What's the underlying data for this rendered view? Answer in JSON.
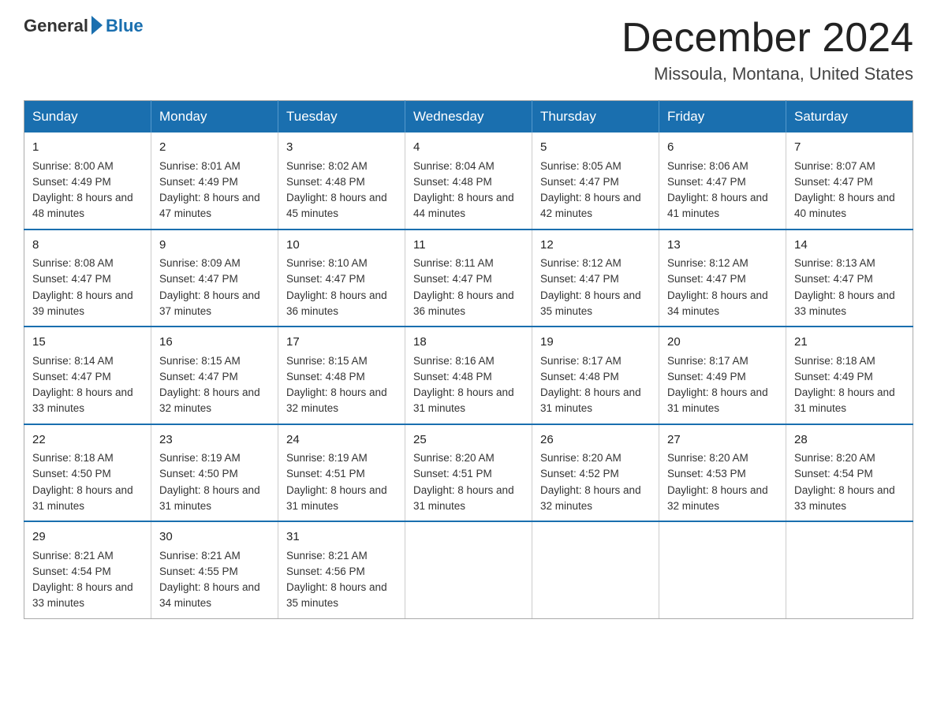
{
  "header": {
    "logo": {
      "general": "General",
      "blue": "Blue"
    },
    "month_title": "December 2024",
    "location": "Missoula, Montana, United States"
  },
  "weekdays": [
    "Sunday",
    "Monday",
    "Tuesday",
    "Wednesday",
    "Thursday",
    "Friday",
    "Saturday"
  ],
  "weeks": [
    [
      {
        "day": "1",
        "sunrise": "8:00 AM",
        "sunset": "4:49 PM",
        "daylight": "8 hours and 48 minutes."
      },
      {
        "day": "2",
        "sunrise": "8:01 AM",
        "sunset": "4:49 PM",
        "daylight": "8 hours and 47 minutes."
      },
      {
        "day": "3",
        "sunrise": "8:02 AM",
        "sunset": "4:48 PM",
        "daylight": "8 hours and 45 minutes."
      },
      {
        "day": "4",
        "sunrise": "8:04 AM",
        "sunset": "4:48 PM",
        "daylight": "8 hours and 44 minutes."
      },
      {
        "day": "5",
        "sunrise": "8:05 AM",
        "sunset": "4:47 PM",
        "daylight": "8 hours and 42 minutes."
      },
      {
        "day": "6",
        "sunrise": "8:06 AM",
        "sunset": "4:47 PM",
        "daylight": "8 hours and 41 minutes."
      },
      {
        "day": "7",
        "sunrise": "8:07 AM",
        "sunset": "4:47 PM",
        "daylight": "8 hours and 40 minutes."
      }
    ],
    [
      {
        "day": "8",
        "sunrise": "8:08 AM",
        "sunset": "4:47 PM",
        "daylight": "8 hours and 39 minutes."
      },
      {
        "day": "9",
        "sunrise": "8:09 AM",
        "sunset": "4:47 PM",
        "daylight": "8 hours and 37 minutes."
      },
      {
        "day": "10",
        "sunrise": "8:10 AM",
        "sunset": "4:47 PM",
        "daylight": "8 hours and 36 minutes."
      },
      {
        "day": "11",
        "sunrise": "8:11 AM",
        "sunset": "4:47 PM",
        "daylight": "8 hours and 36 minutes."
      },
      {
        "day": "12",
        "sunrise": "8:12 AM",
        "sunset": "4:47 PM",
        "daylight": "8 hours and 35 minutes."
      },
      {
        "day": "13",
        "sunrise": "8:12 AM",
        "sunset": "4:47 PM",
        "daylight": "8 hours and 34 minutes."
      },
      {
        "day": "14",
        "sunrise": "8:13 AM",
        "sunset": "4:47 PM",
        "daylight": "8 hours and 33 minutes."
      }
    ],
    [
      {
        "day": "15",
        "sunrise": "8:14 AM",
        "sunset": "4:47 PM",
        "daylight": "8 hours and 33 minutes."
      },
      {
        "day": "16",
        "sunrise": "8:15 AM",
        "sunset": "4:47 PM",
        "daylight": "8 hours and 32 minutes."
      },
      {
        "day": "17",
        "sunrise": "8:15 AM",
        "sunset": "4:48 PM",
        "daylight": "8 hours and 32 minutes."
      },
      {
        "day": "18",
        "sunrise": "8:16 AM",
        "sunset": "4:48 PM",
        "daylight": "8 hours and 31 minutes."
      },
      {
        "day": "19",
        "sunrise": "8:17 AM",
        "sunset": "4:48 PM",
        "daylight": "8 hours and 31 minutes."
      },
      {
        "day": "20",
        "sunrise": "8:17 AM",
        "sunset": "4:49 PM",
        "daylight": "8 hours and 31 minutes."
      },
      {
        "day": "21",
        "sunrise": "8:18 AM",
        "sunset": "4:49 PM",
        "daylight": "8 hours and 31 minutes."
      }
    ],
    [
      {
        "day": "22",
        "sunrise": "8:18 AM",
        "sunset": "4:50 PM",
        "daylight": "8 hours and 31 minutes."
      },
      {
        "day": "23",
        "sunrise": "8:19 AM",
        "sunset": "4:50 PM",
        "daylight": "8 hours and 31 minutes."
      },
      {
        "day": "24",
        "sunrise": "8:19 AM",
        "sunset": "4:51 PM",
        "daylight": "8 hours and 31 minutes."
      },
      {
        "day": "25",
        "sunrise": "8:20 AM",
        "sunset": "4:51 PM",
        "daylight": "8 hours and 31 minutes."
      },
      {
        "day": "26",
        "sunrise": "8:20 AM",
        "sunset": "4:52 PM",
        "daylight": "8 hours and 32 minutes."
      },
      {
        "day": "27",
        "sunrise": "8:20 AM",
        "sunset": "4:53 PM",
        "daylight": "8 hours and 32 minutes."
      },
      {
        "day": "28",
        "sunrise": "8:20 AM",
        "sunset": "4:54 PM",
        "daylight": "8 hours and 33 minutes."
      }
    ],
    [
      {
        "day": "29",
        "sunrise": "8:21 AM",
        "sunset": "4:54 PM",
        "daylight": "8 hours and 33 minutes."
      },
      {
        "day": "30",
        "sunrise": "8:21 AM",
        "sunset": "4:55 PM",
        "daylight": "8 hours and 34 minutes."
      },
      {
        "day": "31",
        "sunrise": "8:21 AM",
        "sunset": "4:56 PM",
        "daylight": "8 hours and 35 minutes."
      },
      null,
      null,
      null,
      null
    ]
  ],
  "labels": {
    "sunrise": "Sunrise: ",
    "sunset": "Sunset: ",
    "daylight": "Daylight: "
  }
}
